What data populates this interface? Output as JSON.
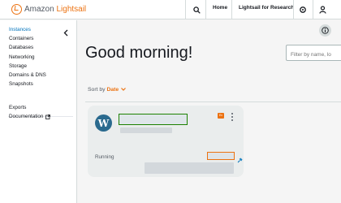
{
  "header": {
    "brand_prefix": "Amazon",
    "brand_name": "Lightsail",
    "brand_color": "#ec7211",
    "search_icon": "search-icon",
    "home_label": "Home",
    "research_label": "Lightsail for Research",
    "settings_icon": "gear-icon",
    "account_icon": "user-icon"
  },
  "sidebar": {
    "items": [
      {
        "label": "Instances",
        "active": true
      },
      {
        "label": "Containers"
      },
      {
        "label": "Databases"
      },
      {
        "label": "Networking"
      },
      {
        "label": "Storage"
      },
      {
        "label": "Domains & DNS"
      },
      {
        "label": "Snapshots"
      }
    ],
    "footer_items": [
      {
        "label": "Exports"
      },
      {
        "label": "Documentation",
        "icon": "external-link-icon"
      }
    ],
    "active_color": "#0073bb"
  },
  "main": {
    "greeting": "Good morning!",
    "filter_placeholder": "Filter by name, lo",
    "sort_prefix": "Sort by",
    "sort_value": "Date",
    "info_icon": "info-icon"
  },
  "instance_card": {
    "blueprint_icon": "wordpress-icon",
    "status": "Running",
    "badge_text": "Ex",
    "name_redacted": true,
    "ip_redacted": true
  }
}
